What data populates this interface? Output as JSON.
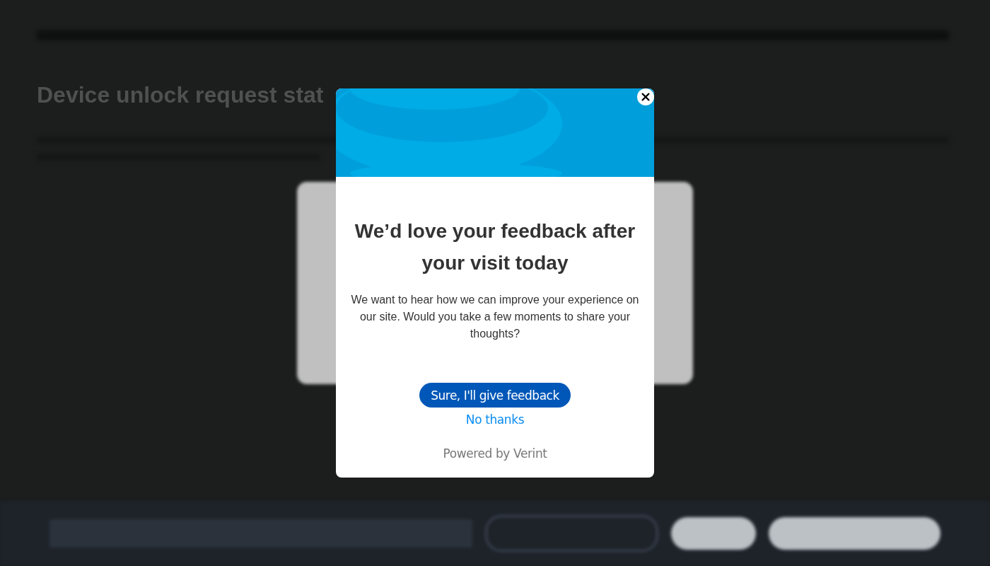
{
  "page": {
    "heading": "Device unlock request stat"
  },
  "survey": {
    "title": "We’d love your feedback after your visit today",
    "message": "We want to hear how we can improve your experience on our site. Would you take a few moments to share your thoughts?",
    "accept_button": "Sure, I'll give feedback",
    "decline_link": "No thanks",
    "footer": "Powered by Verint"
  }
}
